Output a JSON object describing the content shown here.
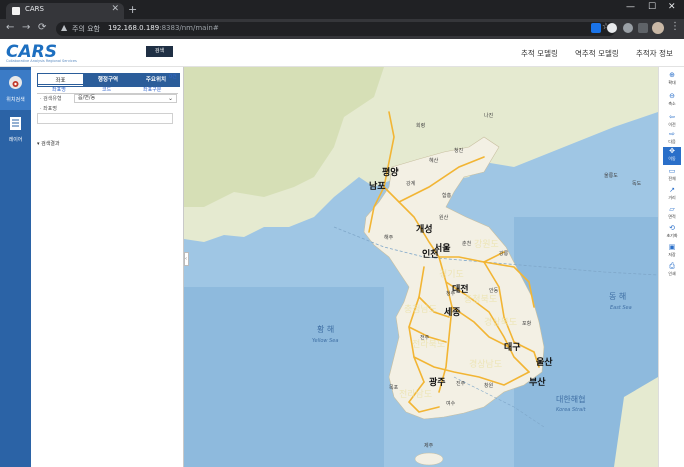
{
  "browser": {
    "tab_title": "CARS",
    "tab_close": "✕",
    "new_tab": "+",
    "window_controls": [
      "—",
      "☐",
      "✕"
    ],
    "security_label": "주의 요함",
    "url_host": "192.168.0.189",
    "url_rest": ":8383/nm/main#",
    "nav": {
      "back": "←",
      "forward": "→",
      "reload": "⟳"
    },
    "warning_icon": "▲",
    "star_icon": "☆"
  },
  "header": {
    "logo": "CARS",
    "logo_sub": "Collaborative Analysis Regional Services",
    "menu": [
      "추적 모델링",
      "역추적 모델링",
      "추적자 정보"
    ]
  },
  "rail": [
    {
      "label": "위치검색",
      "icon": "location-icon",
      "active": true
    },
    {
      "label": "레이어",
      "icon": "layers-icon",
      "active": false
    }
  ],
  "panel": {
    "tabs": [
      "좌표",
      "행정구역",
      "주요위치"
    ],
    "select_label": "· 검색유형",
    "select_value": "읍/면/동",
    "input_label": "· 좌표명",
    "search_button": "검색",
    "results_title": "▾ 검색결과",
    "results_count": "0건",
    "columns": [
      "좌표명",
      "코드",
      "좌표구분"
    ]
  },
  "map": {
    "seas": [
      {
        "ko": "동 해",
        "en": "East Sea"
      },
      {
        "ko": "황 해",
        "en": "Yellow Sea"
      },
      {
        "ko": "대한해협",
        "en": "Korea Strait"
      }
    ],
    "cities": [
      "평양",
      "남포",
      "개성",
      "인천",
      "서울",
      "대전",
      "세종",
      "대구",
      "울산",
      "광주",
      "부산"
    ],
    "provinces": [
      "강원도",
      "경기도",
      "충청북도",
      "충청남도",
      "경상북도",
      "전라북도",
      "경상남도",
      "전라남도"
    ],
    "places": [
      "회령",
      "나진",
      "청진",
      "혜산",
      "강계",
      "함흥",
      "원산",
      "해주",
      "춘천",
      "강릉",
      "포항",
      "목포",
      "여수",
      "제주",
      "울릉도",
      "독도",
      "안동",
      "청주",
      "전주",
      "진주",
      "창원"
    ],
    "accent_road": "#f2b534",
    "land": "#f3f0e4",
    "sea_color": "#9fc6e4"
  },
  "toolbar": [
    {
      "icon": "zoom-in-icon",
      "label": "확대"
    },
    {
      "icon": "zoom-out-icon",
      "label": "축소"
    },
    {
      "icon": "back-icon",
      "label": "이전"
    },
    {
      "icon": "next-icon",
      "label": "다음"
    },
    {
      "icon": "pan-icon",
      "label": "이동"
    },
    {
      "icon": "fullscreen-icon",
      "label": "전체"
    },
    {
      "icon": "distance-icon",
      "label": "거리"
    },
    {
      "icon": "area-icon",
      "label": "면적"
    },
    {
      "icon": "reset-icon",
      "label": "초기화"
    },
    {
      "icon": "save-icon",
      "label": "저장"
    },
    {
      "icon": "print-icon",
      "label": "인쇄"
    }
  ]
}
